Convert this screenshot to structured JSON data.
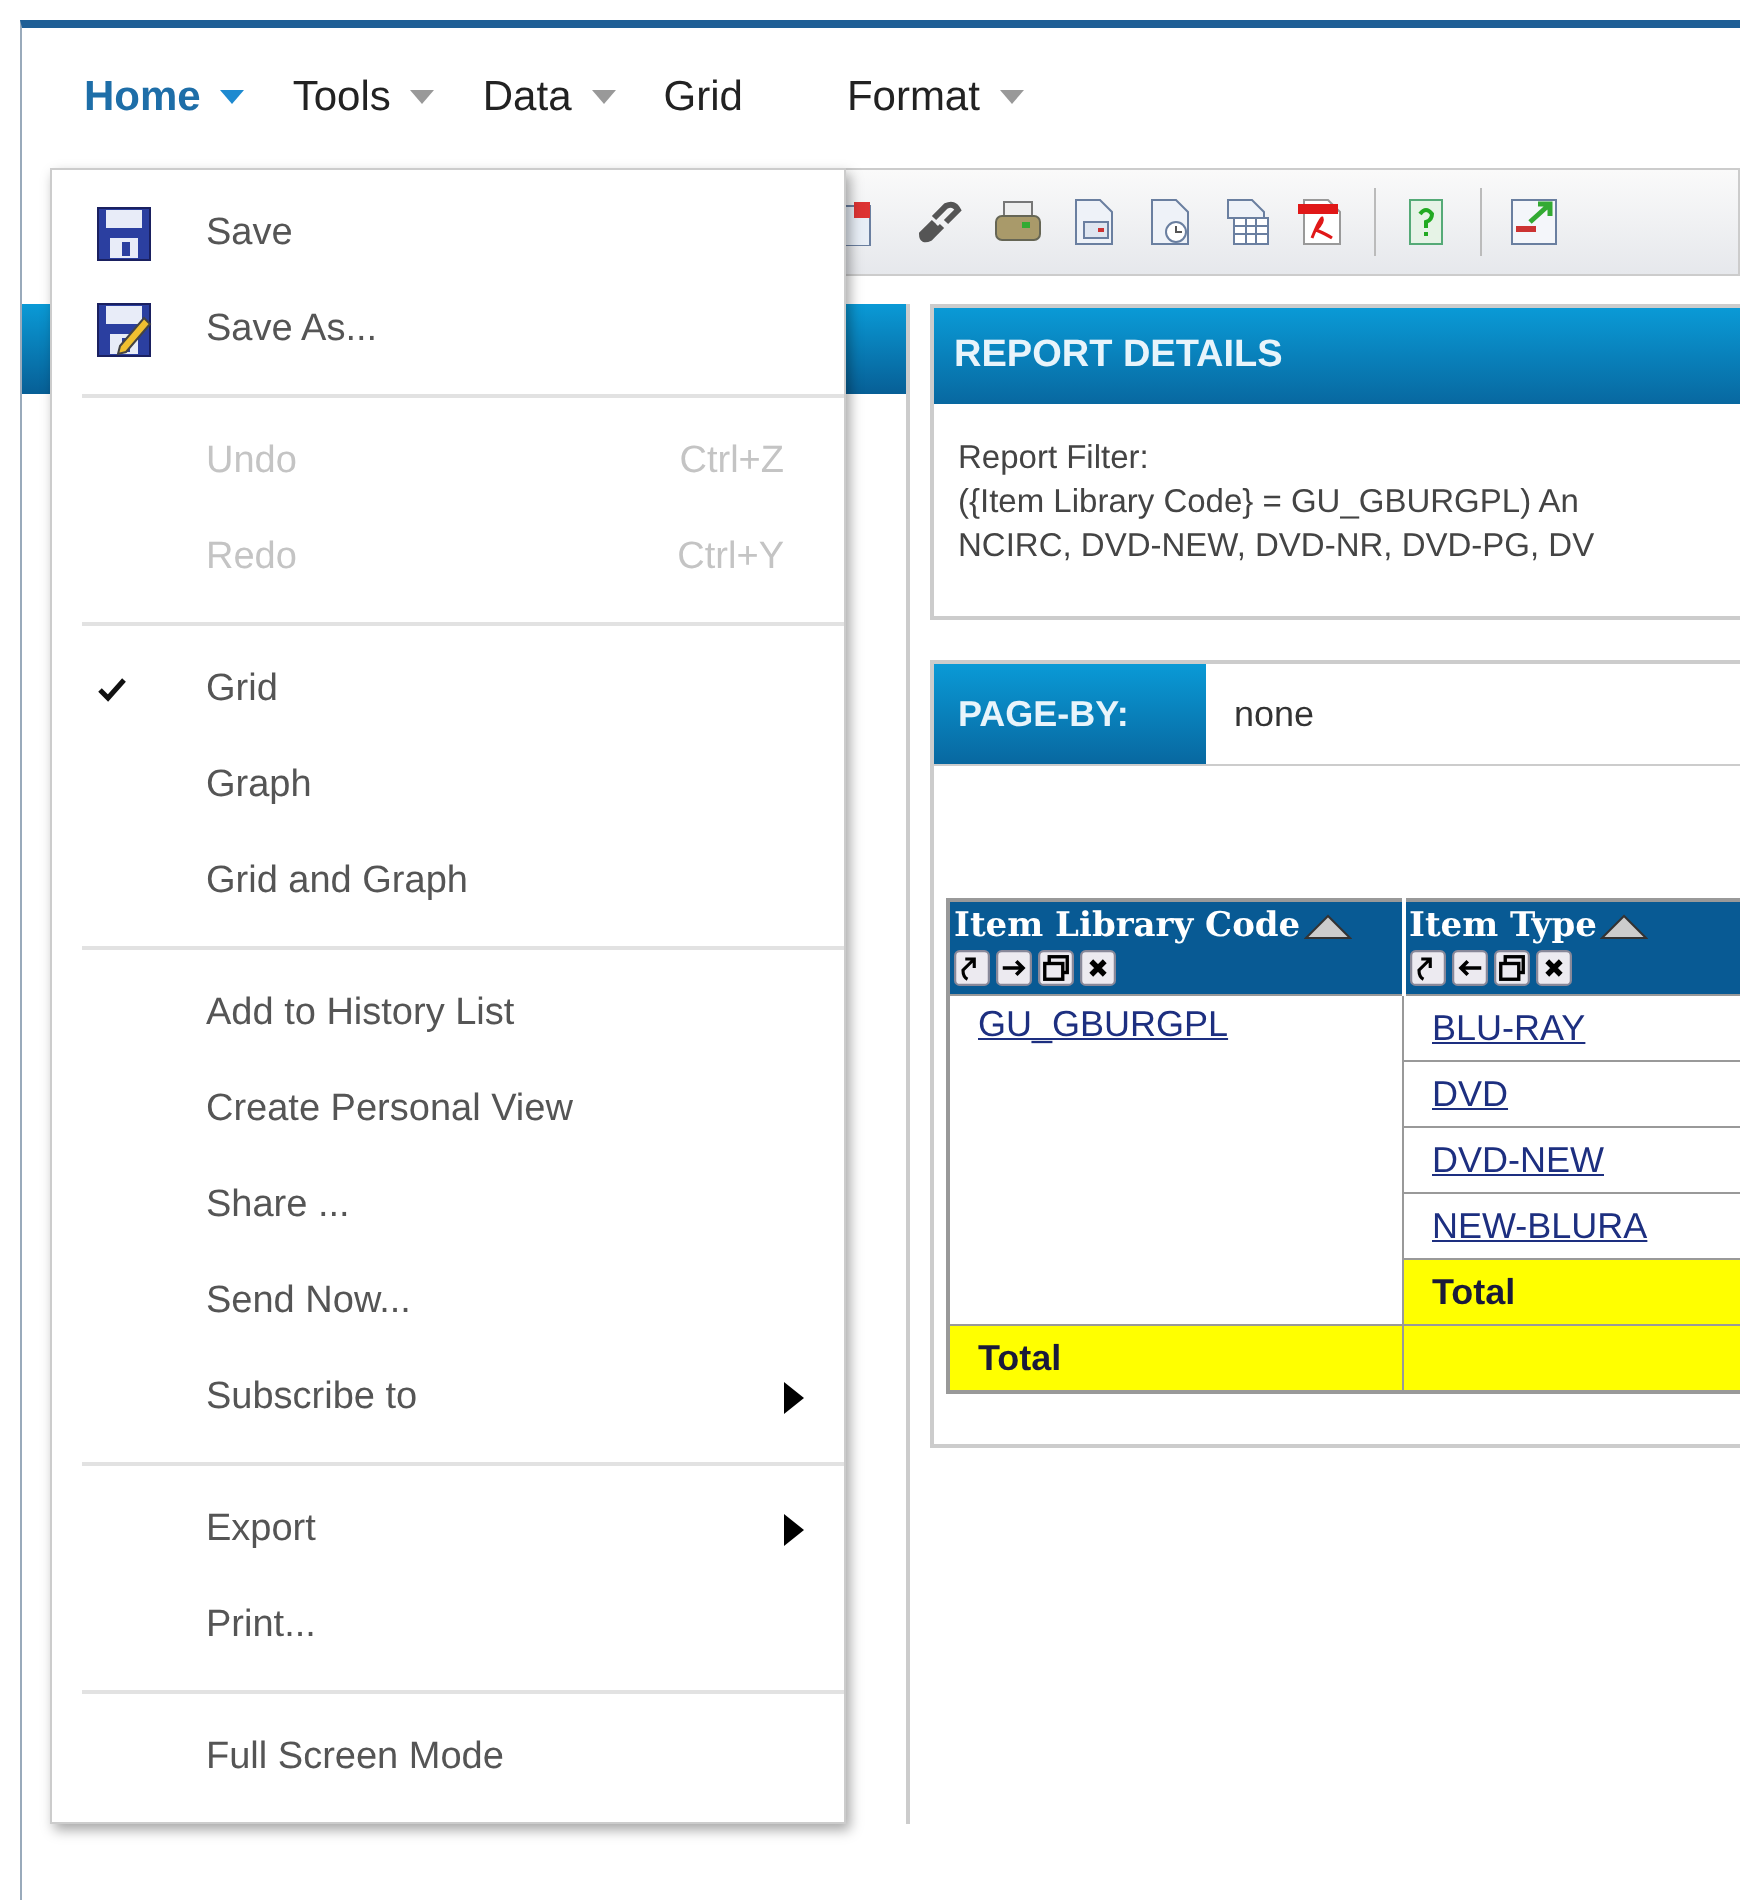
{
  "menubar": [
    {
      "label": "Home",
      "selected": true,
      "dropdown": true
    },
    {
      "label": "Tools",
      "selected": false,
      "dropdown": true
    },
    {
      "label": "Data",
      "selected": false,
      "dropdown": true
    },
    {
      "label": "Grid",
      "selected": false,
      "dropdown": false
    },
    {
      "label": "Format",
      "selected": false,
      "dropdown": true
    }
  ],
  "report_details": {
    "title": "REPORT DETAILS",
    "filter_label": "Report Filter:",
    "filter_lines": [
      "({Item Library Code} = GU_GBURGPL) An",
      "NCIRC, DVD-NEW, DVD-NR, DVD-PG, DV"
    ]
  },
  "page_by": {
    "label": "PAGE-BY:",
    "value": "none"
  },
  "grid": {
    "columns": [
      {
        "label": "Item Library Code"
      },
      {
        "label": "Item Type"
      }
    ],
    "groups": [
      {
        "label": "GU_GBURGPL",
        "items": [
          "BLU-RAY",
          "DVD",
          "DVD-NEW",
          "NEW-BLURA"
        ],
        "subtotal": "Total"
      }
    ],
    "grand_total": "Total"
  },
  "menu": {
    "groups": [
      [
        {
          "label": "Save",
          "disabled": false,
          "submenu": false
        },
        {
          "label": "Save As...",
          "disabled": false,
          "submenu": false
        }
      ],
      [
        {
          "label": "Undo",
          "shortcut": "Ctrl+Z",
          "disabled": true,
          "submenu": false
        },
        {
          "label": "Redo",
          "shortcut": "Ctrl+Y",
          "disabled": true,
          "submenu": false
        }
      ],
      [
        {
          "label": "Grid",
          "checked": true,
          "disabled": false,
          "submenu": false
        },
        {
          "label": "Graph",
          "checked": false,
          "disabled": false,
          "submenu": false
        },
        {
          "label": "Grid and Graph",
          "checked": false,
          "disabled": false,
          "submenu": false
        }
      ],
      [
        {
          "label": "Add to History List",
          "disabled": false,
          "submenu": false
        },
        {
          "label": "Create Personal View",
          "disabled": false,
          "submenu": false
        },
        {
          "label": "Share ...",
          "disabled": false,
          "submenu": false
        },
        {
          "label": "Send Now...",
          "disabled": false,
          "submenu": false
        },
        {
          "label": "Subscribe to",
          "disabled": false,
          "submenu": true
        }
      ],
      [
        {
          "label": "Export",
          "disabled": false,
          "submenu": true
        },
        {
          "label": "Print...",
          "disabled": false,
          "submenu": false
        }
      ],
      [
        {
          "label": "Full Screen Mode",
          "disabled": false,
          "submenu": false
        }
      ]
    ]
  }
}
